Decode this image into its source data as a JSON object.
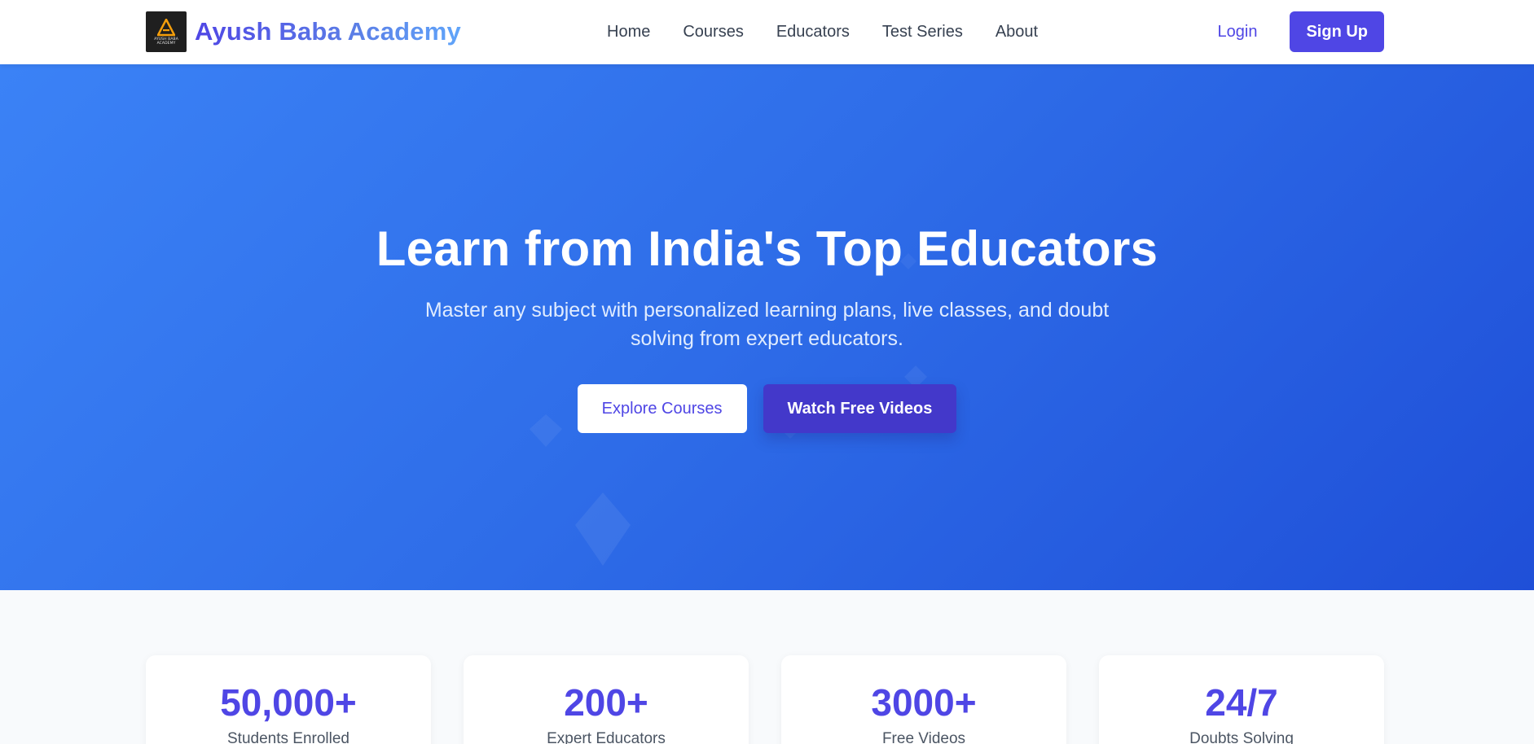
{
  "brand": {
    "logo_text": [
      "AYUSH BABA",
      "ACADEMY"
    ],
    "name": "Ayush Baba Academy",
    "accent": "#4f46e5"
  },
  "nav": {
    "links": [
      "Home",
      "Courses",
      "Educators",
      "Test Series",
      "About"
    ],
    "login": "Login",
    "signup": "Sign Up"
  },
  "hero": {
    "title": "Learn from India's Top Educators",
    "subtitle": "Master any subject with personalized learning plans, live classes, and doubt solving from expert educators.",
    "primary_button": "Explore Courses",
    "secondary_button": "Watch Free Videos",
    "gradient": [
      "#3b82f6",
      "#1f4fd8"
    ]
  },
  "stats": [
    {
      "value": "50,000+",
      "label": "Students Enrolled"
    },
    {
      "value": "200+",
      "label": "Expert Educators"
    },
    {
      "value": "3000+",
      "label": "Free Videos"
    },
    {
      "value": "24/7",
      "label": "Doubts Solving"
    }
  ]
}
